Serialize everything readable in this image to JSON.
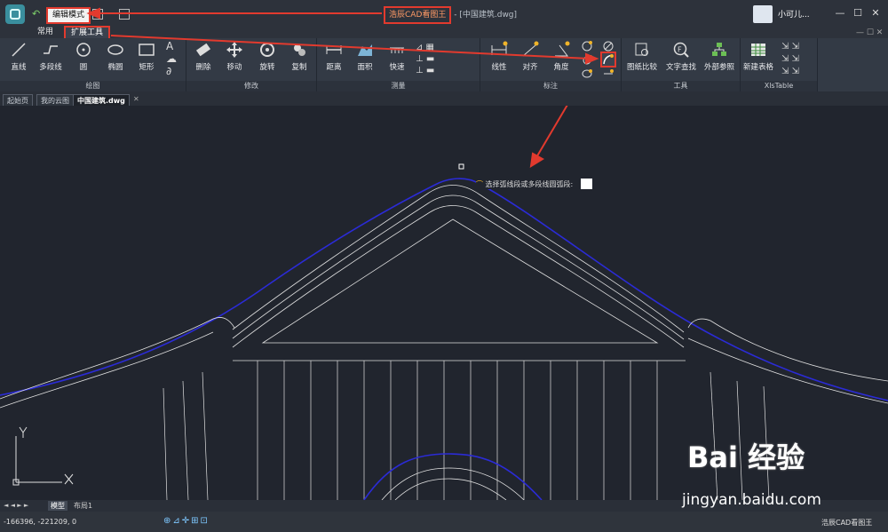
{
  "titlebar": {
    "mode_label": "编辑模式",
    "app_title": "浩辰CAD看图王",
    "file_title": "- [中国建筑.dwg]",
    "user_name": "小可儿..."
  },
  "menu": {
    "tabs": [
      "常用",
      "扩展工具"
    ]
  },
  "ribbon": {
    "groups": [
      "绘图",
      "修改",
      "测量",
      "标注",
      "工具",
      "XlsTable"
    ],
    "draw": [
      "直线",
      "多段线",
      "圆",
      "椭圆",
      "矩形"
    ],
    "modify": [
      "删除",
      "移动",
      "旋转",
      "复制"
    ],
    "measure": [
      "距离",
      "面积",
      "快速"
    ],
    "annotate": [
      "线性",
      "对齐",
      "角度"
    ],
    "tools": [
      "图纸比较",
      "文字查找",
      "外部参照"
    ],
    "xls": [
      "新建表格"
    ]
  },
  "doc_tabs": [
    "起始页",
    "我的云图",
    "中国建筑.dwg"
  ],
  "canvas": {
    "prompt": "选择弧线段或多段线圆弧段:"
  },
  "layout_tabs": [
    "模型",
    "布局1"
  ],
  "status": {
    "coords": "-166396, -221209, 0",
    "right_label": "浩辰CAD看图王"
  },
  "watermark": {
    "brand": "Bai 经验",
    "url": "jingyan.baidu.com"
  },
  "colors": {
    "accent_red": "#e23a2e",
    "curve_blue": "#2b2bd6",
    "canvas_bg": "#21252e"
  }
}
